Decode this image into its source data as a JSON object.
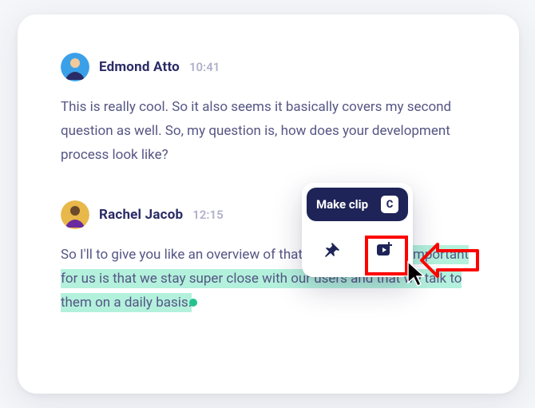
{
  "messages": [
    {
      "author": "Edmond Atto",
      "time": "10:41",
      "body_plain": "This is really cool. So it also seems it basically covers my second question as well. So, my question is, how does your development process look like?"
    },
    {
      "author": "Rachel Jacob",
      "time": "12:15",
      "body_pre": "So I'll to give you like an overview of that. But what's ",
      "body_highlight": "most important for us is that we stay super close with our users and that we talk to them on a daily basis.",
      "body_post": ""
    }
  ],
  "popover": {
    "title": "Make clip",
    "shortcut": "C",
    "pin_label": "pin-icon",
    "clip_label": "make-clip-icon"
  },
  "annotations": {
    "highlight_target": "make-clip-button",
    "pointer_direction": "left"
  }
}
